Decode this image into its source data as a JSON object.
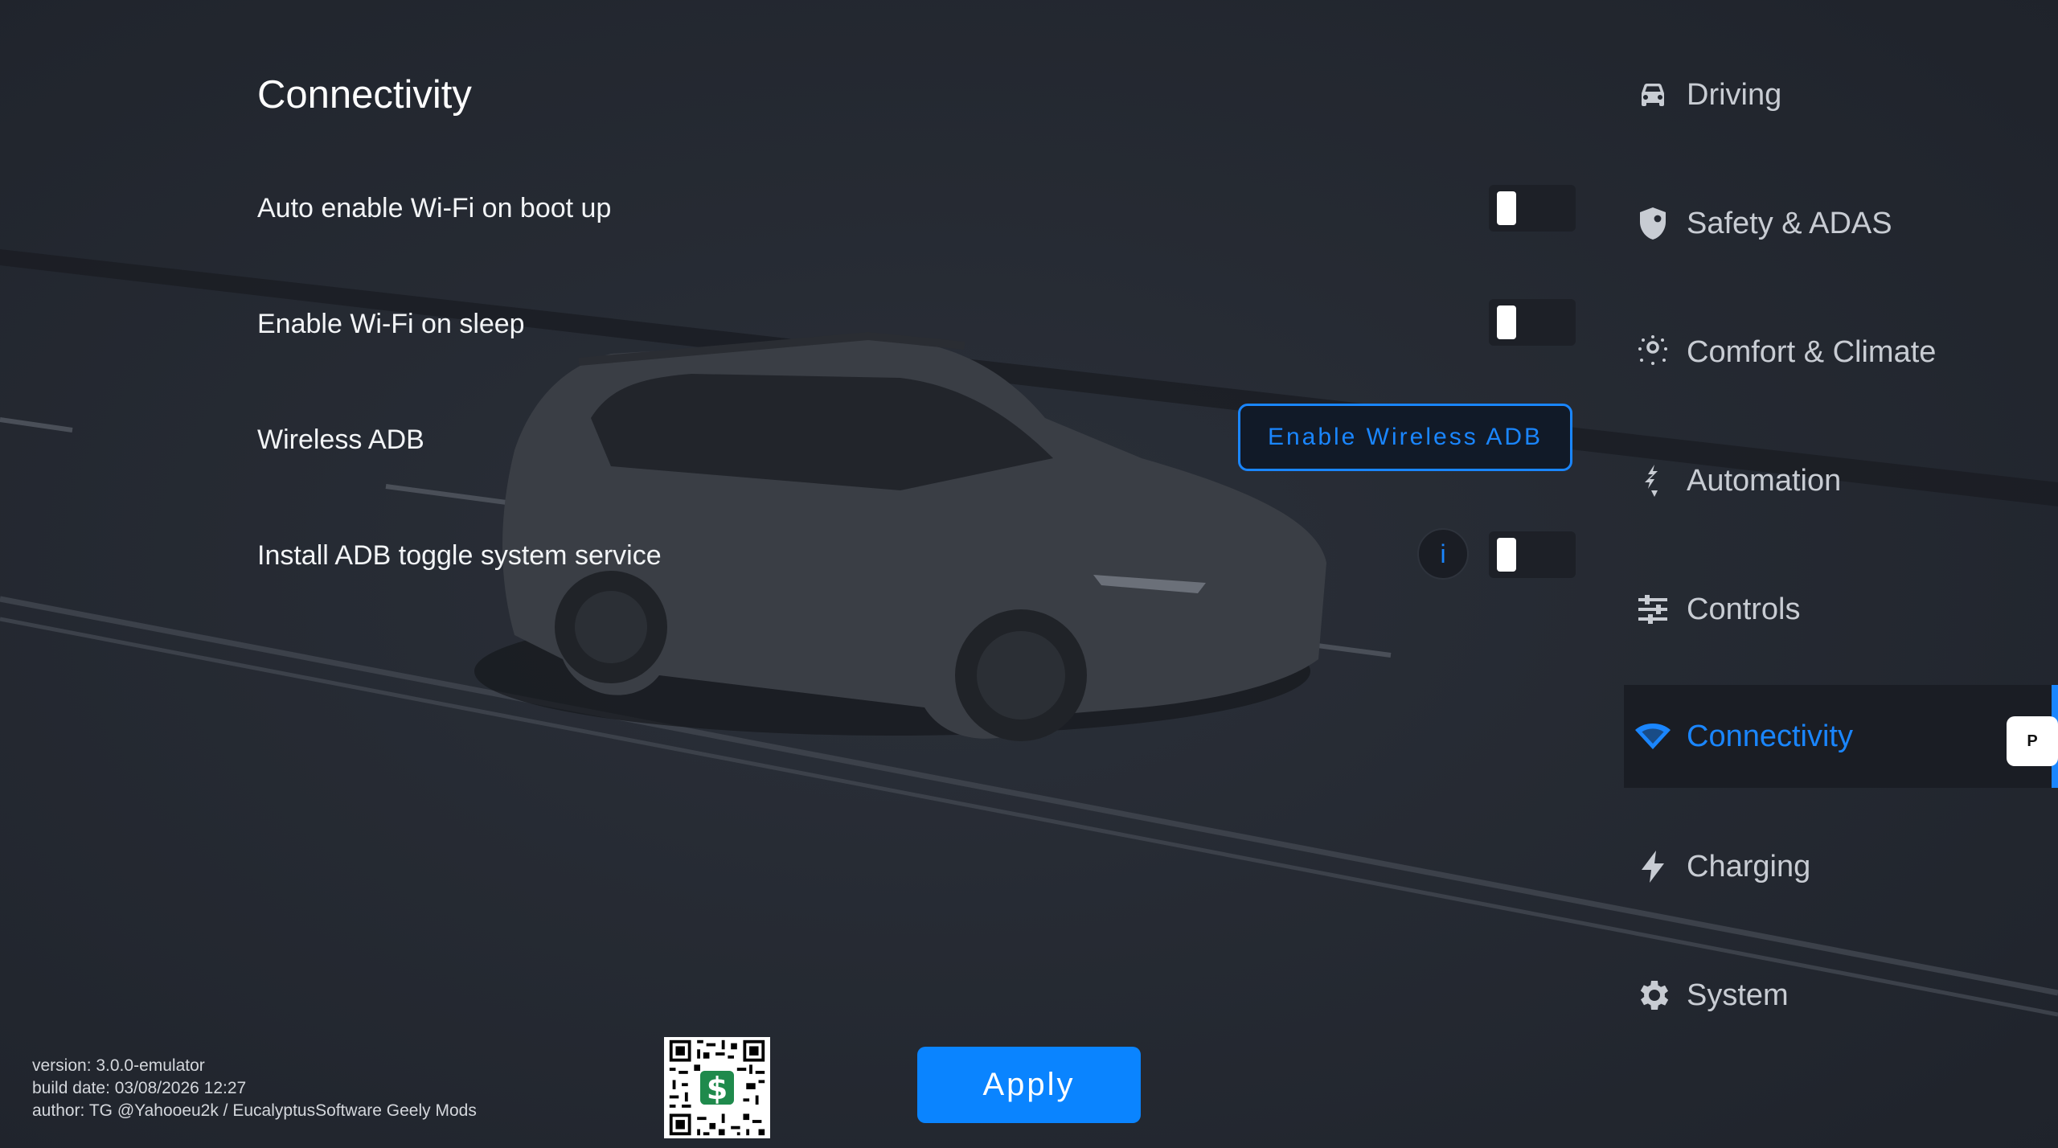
{
  "page": {
    "title": "Connectivity"
  },
  "settings": [
    {
      "label": "Auto enable Wi-Fi on boot up",
      "control": "toggle",
      "enabled": false
    },
    {
      "label": "Enable Wi-Fi on sleep",
      "control": "toggle",
      "enabled": false
    },
    {
      "label": "Wireless ADB",
      "control": "button",
      "button_label": "Enable Wireless ADB"
    },
    {
      "label": "Install ADB toggle system service",
      "control": "toggle",
      "enabled": false,
      "info_label": "i"
    }
  ],
  "sidebar": {
    "items": [
      {
        "label": "Driving",
        "icon": "car-icon"
      },
      {
        "label": "Safety & ADAS",
        "icon": "shield-icon"
      },
      {
        "label": "Comfort & Climate",
        "icon": "climate-icon"
      },
      {
        "label": "Automation",
        "icon": "automation-icon"
      },
      {
        "label": "Controls",
        "icon": "sliders-icon"
      },
      {
        "label": "Connectivity",
        "icon": "wifi-icon",
        "active": true
      },
      {
        "label": "Charging",
        "icon": "lightning-icon"
      },
      {
        "label": "System",
        "icon": "gear-icon"
      }
    ],
    "badge": "P"
  },
  "footer": {
    "version": "version: 3.0.0-emulator",
    "build_date": "build date: 03/08/2026 12:27",
    "author": "author: TG @Yahooeu2k / EucalyptusSoftware Geely Mods",
    "qr_symbol": "$",
    "apply_label": "Apply"
  },
  "colors": {
    "accent": "#1a86ff",
    "background": "#252932",
    "text": "#ffffff"
  }
}
